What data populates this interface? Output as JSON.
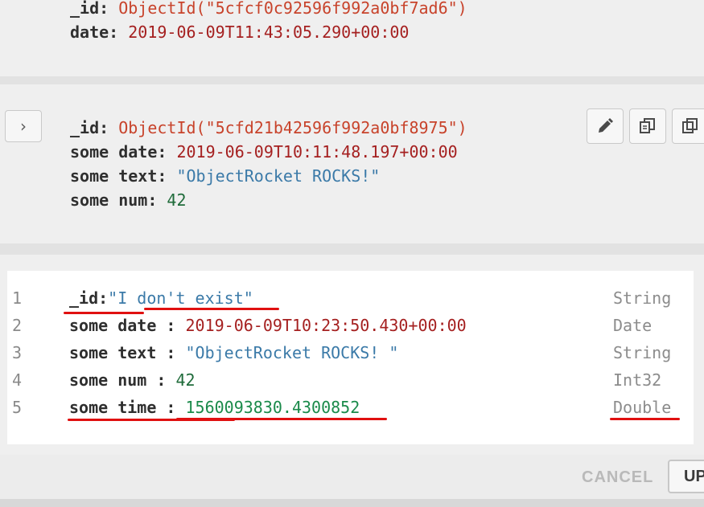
{
  "doc1": {
    "id_key": "_id",
    "id_value": "ObjectId(\"5cfcf0c92596f992a0bf7ad6\")",
    "date_key": "date",
    "date_value": "2019-06-09T11:43:05.290+00:00"
  },
  "doc2": {
    "id_key": "_id",
    "id_value": "ObjectId(\"5cfd21b42596f992a0bf8975\")",
    "date_key": "some date",
    "date_value": "2019-06-09T10:11:48.197+00:00",
    "text_key": "some text",
    "text_value": "\"ObjectRocket ROCKS!\"",
    "num_key": "some num",
    "num_value": "42",
    "expand_icon": "chevron-right-icon",
    "edit_icon": "pencil-icon",
    "copy_icon": "copy-icon",
    "clone_icon": "clone-icon"
  },
  "editor": {
    "lines": [
      {
        "no": "1",
        "key": "_id",
        "sep": ":",
        "value": "\"I don't exist\"",
        "type": "String"
      },
      {
        "no": "2",
        "key": "some date",
        "sep": " :",
        "value": "2019-06-09T10:23:50.430+00:00",
        "type": "Date"
      },
      {
        "no": "3",
        "key": "some text",
        "sep": " :",
        "value": "\"ObjectRocket ROCKS! \"",
        "type": "String"
      },
      {
        "no": "4",
        "key": "some num",
        "sep": " :",
        "value": "42",
        "type": "Int32"
      },
      {
        "no": "5",
        "key": "some time",
        "sep": " :",
        "value": "1560093830.4300852",
        "type": "Double"
      }
    ],
    "annotation_color": "#e01010"
  },
  "footer": {
    "cancel_label": "CANCEL",
    "update_label": "UPDATE"
  }
}
